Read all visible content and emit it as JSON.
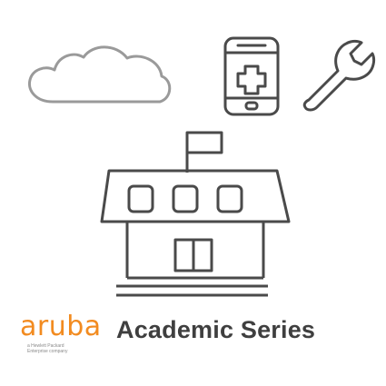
{
  "brand": {
    "name": "aruba",
    "tagline_line1": "a Hewlett Packard",
    "tagline_line2": "Enterprise company",
    "accent_color": "#f28b20"
  },
  "title": "Academic Series",
  "colors": {
    "icon_stroke": "#4a4a4a",
    "title_text": "#3f3f3f",
    "background": "#ffffff"
  },
  "icons": [
    "cloud-icon",
    "mobile-device-medical-icon",
    "wrench-icon",
    "school-building-icon"
  ]
}
